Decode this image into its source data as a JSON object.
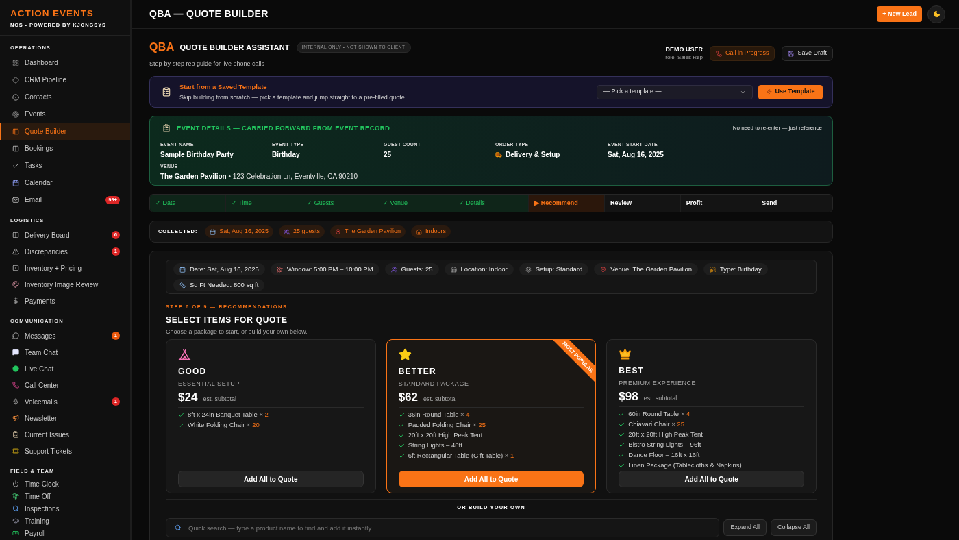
{
  "sidebar": {
    "brand": "ACTION EVENTS",
    "tagline": "NCS • POWERED BY KJONGSYS",
    "sections": [
      {
        "title": "OPERATIONS",
        "items": [
          {
            "label": "Dashboard",
            "selected": false
          },
          {
            "label": "CRM Pipeline",
            "selected": false
          },
          {
            "label": "Contacts",
            "selected": false
          },
          {
            "label": "Events",
            "selected": false
          },
          {
            "label": "Quote Builder",
            "selected": true
          },
          {
            "label": "Bookings",
            "selected": false
          },
          {
            "label": "Tasks",
            "selected": false
          },
          {
            "label": "Calendar",
            "selected": false
          },
          {
            "label": "Email",
            "selected": false,
            "badge": {
              "text": "99+",
              "color": "#dc2626"
            }
          }
        ]
      },
      {
        "title": "LOGISTICS",
        "items": [
          {
            "label": "Delivery Board",
            "selected": false,
            "badge": {
              "text": "6",
              "color": "#dc2626"
            }
          },
          {
            "label": "Discrepancies",
            "selected": false,
            "badge": {
              "text": "1",
              "color": "#dc2626"
            }
          },
          {
            "label": "Inventory + Pricing",
            "selected": false
          },
          {
            "label": "Inventory Image Review",
            "selected": false
          },
          {
            "label": "Payments",
            "selected": false
          }
        ]
      },
      {
        "title": "COMMUNICATION",
        "items": [
          {
            "label": "Messages",
            "selected": false,
            "badge": {
              "text": "1",
              "color": "#ea580c"
            }
          },
          {
            "label": "Team Chat",
            "selected": false
          },
          {
            "label": "Live Chat",
            "selected": false
          },
          {
            "label": "Call Center",
            "selected": false
          },
          {
            "label": "Voicemails",
            "selected": false,
            "badge": {
              "text": "1",
              "color": "#dc2626"
            }
          },
          {
            "label": "Newsletter",
            "selected": false
          },
          {
            "label": "Current Issues",
            "selected": false
          },
          {
            "label": "Support Tickets",
            "selected": false
          }
        ]
      },
      {
        "title": "FIELD & TEAM",
        "items": [
          {
            "label": "Time Clock",
            "selected": false
          },
          {
            "label": "Time Off",
            "selected": false
          },
          {
            "label": "Inspections",
            "selected": false
          },
          {
            "label": "Training",
            "selected": false
          },
          {
            "label": "Payroll",
            "selected": false
          }
        ]
      }
    ]
  },
  "header": {
    "title": "QBA — QUOTE BUILDER",
    "new_lead": "+ New Lead"
  },
  "assistant": {
    "code": "QBA",
    "title": "QUOTE BUILDER ASSISTANT",
    "badge": "INTERNAL ONLY • NOT SHOWN TO CLIENT",
    "subtitle": "Step-by-step rep guide for live phone calls",
    "user": {
      "name": "DEMO USER",
      "role": "role: Sales Rep"
    },
    "call_button": "Call in Progress",
    "save_button": "Save Draft"
  },
  "template": {
    "title": "Start from a Saved Template",
    "description": "Skip building from scratch — pick a template and jump straight to a pre-filled quote.",
    "select": {
      "placeholder": "— Pick a template —"
    },
    "button": "Use Template"
  },
  "event_details": {
    "title": "EVENT DETAILS — CARRIED FORWARD FROM EVENT RECORD",
    "note": "No need to re-enter — just reference",
    "fields": [
      {
        "label": "EVENT NAME",
        "value": "Sample Birthday Party"
      },
      {
        "label": "EVENT TYPE",
        "value": "Birthday"
      },
      {
        "label": "GUEST COUNT",
        "value": "25"
      },
      {
        "label": "ORDER TYPE",
        "value": "Delivery & Setup"
      },
      {
        "label": "EVENT START DATE",
        "value": "Sat, Aug 16, 2025"
      }
    ],
    "venue": {
      "label": "VENUE",
      "value": "**The Garden Pavilion** • 123 Celebration Ln, Eventville, CA 90210"
    }
  },
  "steps": [
    {
      "mark": "✓",
      "label": "Date",
      "done": true,
      "selected": false
    },
    {
      "mark": "✓",
      "label": "Time",
      "done": true,
      "selected": false
    },
    {
      "mark": "✓",
      "label": "Guests",
      "done": true,
      "selected": false
    },
    {
      "mark": "✓",
      "label": "Venue",
      "done": true,
      "selected": false
    },
    {
      "mark": "✓",
      "label": "Details",
      "done": true,
      "selected": false
    },
    {
      "mark": "▶",
      "label": "Recommend",
      "done": false,
      "selected": true
    },
    {
      "label": "Review",
      "done": false,
      "selected": false
    },
    {
      "label": "Profit",
      "done": false,
      "selected": false
    },
    {
      "label": "Send",
      "done": false,
      "selected": false
    }
  ],
  "collected": {
    "label": "COLLECTED:",
    "chips": [
      "Sat, Aug 16, 2025",
      "25 guests",
      "The Garden Pavilion",
      "Indoors"
    ]
  },
  "summary_chips": [
    "Date: Sat, Aug 16, 2025",
    "Window: 5:00 PM – 10:00 PM",
    "Guests: 25",
    "Location: Indoor",
    "Setup: Standard",
    "Venue: The Garden Pavilion",
    "Type: Birthday",
    "Sq Ft Needed: 800 sq ft"
  ],
  "recommendations": {
    "step": "STEP 6 OF 9 — RECOMMENDATIONS",
    "title": "SELECT ITEMS FOR QUOTE",
    "subtitle": "Choose a package to start, or build your own below.",
    "packages": [
      {
        "name": "GOOD",
        "tier": "ESSENTIAL SETUP",
        "price": "$24",
        "price_note": "est. subtotal",
        "featured": false,
        "items": [
          {
            "name": "8ft x 24in Banquet Table",
            "times": "×",
            "qty": "2"
          },
          {
            "name": "White Folding Chair",
            "times": "×",
            "qty": "20"
          }
        ],
        "button": "Add All to Quote"
      },
      {
        "name": "BETTER",
        "tier": "STANDARD PACKAGE",
        "price": "$62",
        "price_note": "est. subtotal",
        "featured": true,
        "ribbon": "MOST POPULAR",
        "items": [
          {
            "name": "36in Round Table",
            "times": "×",
            "qty": "4"
          },
          {
            "name": "Padded Folding Chair",
            "times": "×",
            "qty": "25"
          },
          {
            "name": "20ft x 20ft High Peak Tent"
          },
          {
            "name": "String Lights – 48ft"
          },
          {
            "name": "6ft Rectangular Table (Gift Table)",
            "times": "×",
            "qty": "1"
          }
        ],
        "button": "Add All to Quote"
      },
      {
        "name": "BEST",
        "tier": "PREMIUM EXPERIENCE",
        "price": "$98",
        "price_note": "est. subtotal",
        "featured": false,
        "items": [
          {
            "name": "60in Round Table",
            "times": "×",
            "qty": "4"
          },
          {
            "name": "Chiavari Chair",
            "times": "×",
            "qty": "25"
          },
          {
            "name": "20ft x 20ft High Peak Tent"
          },
          {
            "name": "Bistro String Lights – 96ft"
          },
          {
            "name": "Dance Floor – 16ft x 16ft"
          },
          {
            "name": "Linen Package (Tablecloths & Napkins)"
          }
        ],
        "button": "Add All to Quote"
      }
    ]
  },
  "build_own": {
    "divider": "OR BUILD YOUR OWN",
    "search": {
      "placeholder": "Quick search — type a product name to find and add it instantly..."
    },
    "buttons": [
      "Expand All",
      "Collapse All"
    ]
  }
}
